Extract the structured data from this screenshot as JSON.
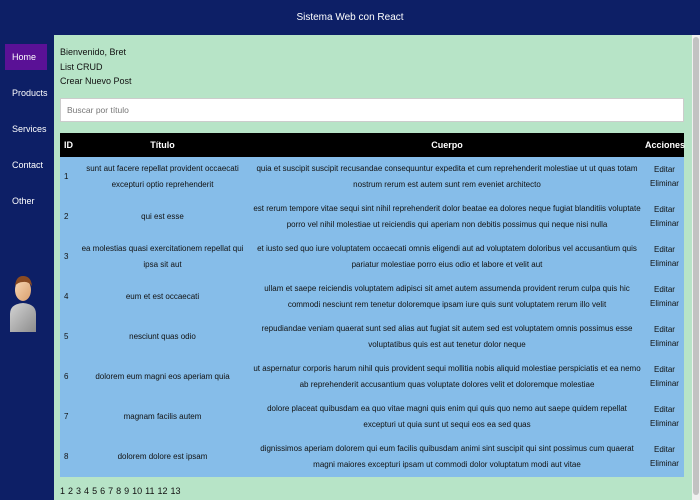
{
  "header": {
    "title": "Sistema Web con React"
  },
  "sidebar": {
    "items": [
      {
        "label": "Home",
        "active": true
      },
      {
        "label": "Products"
      },
      {
        "label": "Services"
      },
      {
        "label": "Contact"
      },
      {
        "label": "Other"
      }
    ],
    "avatar_icon": "user-avatar-icon"
  },
  "main": {
    "welcome": "Bienvenido, Bret",
    "list_link": "List CRUD",
    "create_link": "Crear Nuevo Post",
    "search": {
      "placeholder": "Buscar por título",
      "value": ""
    },
    "table": {
      "columns": [
        "ID",
        "Título",
        "Cuerpo",
        "Acciones"
      ],
      "rows": [
        {
          "id": "1",
          "title": "sunt aut facere repellat provident occaecati excepturi optio reprehenderit",
          "body": "quia et suscipit suscipit recusandae consequuntur expedita et cum reprehenderit molestiae ut ut quas totam nostrum rerum est autem sunt rem eveniet architecto",
          "edit": "Editar",
          "delete": "Eliminar"
        },
        {
          "id": "2",
          "title": "qui est esse",
          "body": "est rerum tempore vitae sequi sint nihil reprehenderit dolor beatae ea dolores neque fugiat blanditiis voluptate porro vel nihil molestiae ut reiciendis qui aperiam non debitis possimus qui neque nisi nulla",
          "edit": "Editar",
          "delete": "Eliminar"
        },
        {
          "id": "3",
          "title": "ea molestias quasi exercitationem repellat qui ipsa sit aut",
          "body": "et iusto sed quo iure voluptatem occaecati omnis eligendi aut ad voluptatem doloribus vel accusantium quis pariatur molestiae porro eius odio et labore et velit aut",
          "edit": "Editar",
          "delete": "Eliminar"
        },
        {
          "id": "4",
          "title": "eum et est occaecati",
          "body": "ullam et saepe reiciendis voluptatem adipisci sit amet autem assumenda provident rerum culpa quis hic commodi nesciunt rem tenetur doloremque ipsam iure quis sunt voluptatem rerum illo velit",
          "edit": "Editar",
          "delete": "Eliminar"
        },
        {
          "id": "5",
          "title": "nesciunt quas odio",
          "body": "repudiandae veniam quaerat sunt sed alias aut fugiat sit autem sed est voluptatem omnis possimus esse voluptatibus quis est aut tenetur dolor neque",
          "edit": "Editar",
          "delete": "Eliminar"
        },
        {
          "id": "6",
          "title": "dolorem eum magni eos aperiam quia",
          "body": "ut aspernatur corporis harum nihil quis provident sequi mollitia nobis aliquid molestiae perspiciatis et ea nemo ab reprehenderit accusantium quas voluptate dolores velit et doloremque molestiae",
          "edit": "Editar",
          "delete": "Eliminar"
        },
        {
          "id": "7",
          "title": "magnam facilis autem",
          "body": "dolore placeat quibusdam ea quo vitae magni quis enim qui quis quo nemo aut saepe quidem repellat excepturi ut quia sunt ut sequi eos ea sed quas",
          "edit": "Editar",
          "delete": "Eliminar"
        },
        {
          "id": "8",
          "title": "dolorem dolore est ipsam",
          "body": "dignissimos aperiam dolorem qui eum facilis quibusdam animi sint suscipit qui sint possimus cum quaerat magni maiores excepturi ipsam ut commodi dolor voluptatum modi aut vitae",
          "edit": "Editar",
          "delete": "Eliminar"
        }
      ]
    },
    "pagination": [
      "1",
      "2",
      "3",
      "4",
      "5",
      "6",
      "7",
      "8",
      "9",
      "10",
      "11",
      "12",
      "13"
    ]
  },
  "colors": {
    "header_bg": "#0d1f66",
    "sidebar_active": "#5a1196",
    "content_bg": "#b7e4c7",
    "row_bg": "#86bde9",
    "table_header_bg": "#000000"
  }
}
